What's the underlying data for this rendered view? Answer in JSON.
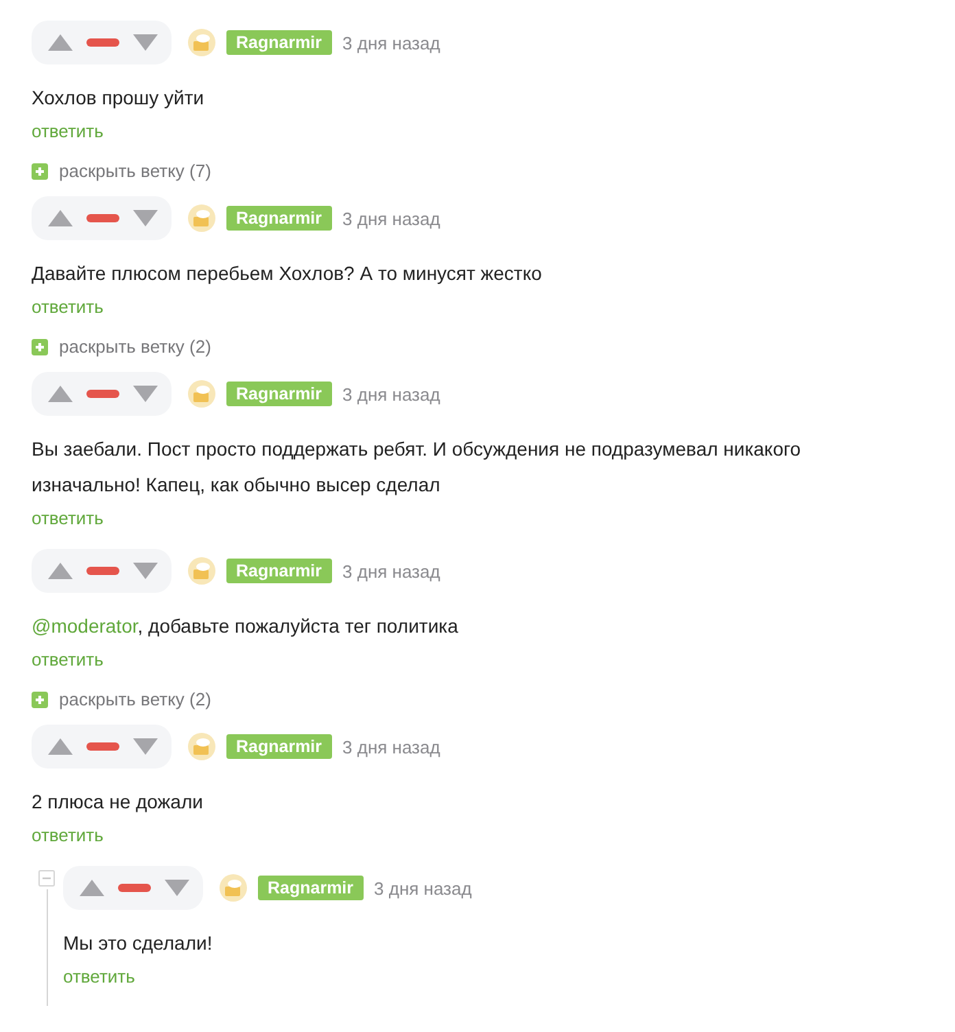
{
  "comments": [
    {
      "author": "Ragnarmir",
      "time": "3 дня назад",
      "text": "Хохлов прошу уйти",
      "reply": "ответить",
      "expand": "раскрыть ветку (7)"
    },
    {
      "author": "Ragnarmir",
      "time": "3 дня назад",
      "text": "Давайте плюсом перебьем Хохлов? А то минусят жестко",
      "reply": "ответить",
      "expand": "раскрыть ветку (2)"
    },
    {
      "author": "Ragnarmir",
      "time": "3 дня назад",
      "text": "Вы заебали. Пост просто поддержать ребят. И обсуждения не подразумевал никакого изначально! Капец, как обычно высер сделал",
      "reply": "ответить"
    },
    {
      "author": "Ragnarmir",
      "time": "3 дня назад",
      "mention": "@moderator",
      "text": ", добавьте пожалуйста тег политика",
      "reply": "ответить",
      "expand": "раскрыть ветку (2)"
    },
    {
      "author": "Ragnarmir",
      "time": "3 дня назад",
      "text": "2 плюса не дожали",
      "reply": "ответить",
      "children": [
        {
          "author": "Ragnarmir",
          "time": "3 дня назад",
          "text": "Мы это сделали!",
          "reply": "ответить"
        }
      ]
    }
  ]
}
